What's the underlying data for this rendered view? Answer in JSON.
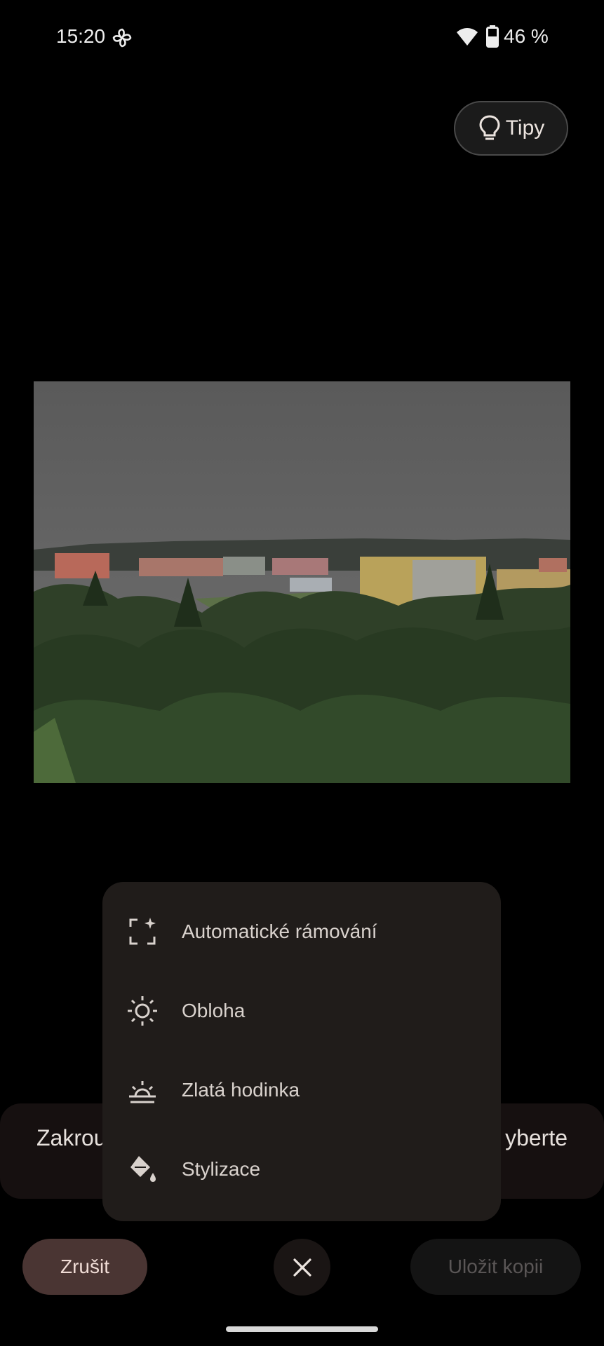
{
  "status_bar": {
    "time": "15:20",
    "battery": "46 %"
  },
  "tips": {
    "label": "Tipy"
  },
  "suggestion_bar": {
    "left_text": "Zakrou",
    "right_text": "yberte"
  },
  "menu": {
    "items": [
      {
        "label": "Automatické rámování",
        "icon": "auto-frame-icon"
      },
      {
        "label": "Obloha",
        "icon": "sun-icon"
      },
      {
        "label": "Zlatá hodinka",
        "icon": "sunset-icon"
      },
      {
        "label": "Stylizace",
        "icon": "paint-bucket-icon"
      }
    ]
  },
  "actions": {
    "cancel_label": "Zrušit",
    "save_copy_label": "Uložit kopii"
  },
  "colors": {
    "background": "#000000",
    "menu_bg": "#201c1a",
    "cancel_bg": "#4a3533"
  }
}
